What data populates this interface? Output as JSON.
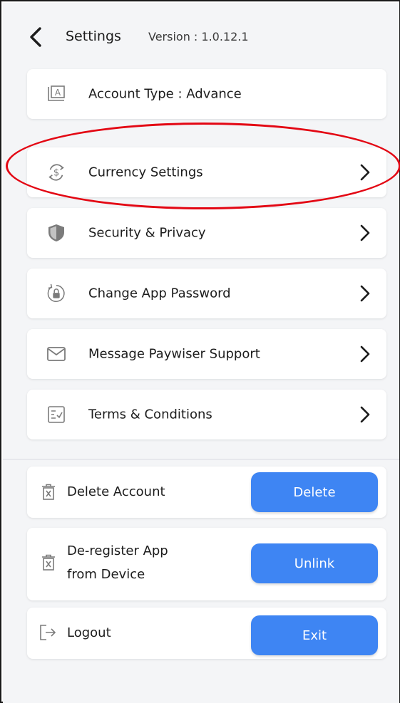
{
  "header": {
    "title": "Settings",
    "version": "Version : 1.0.12.1"
  },
  "menu": {
    "account_type": "Account Type : Advance",
    "currency": "Currency Settings",
    "security": "Security & Privacy",
    "password": "Change App Password",
    "support": "Message Paywiser Support",
    "terms": "Terms & Conditions"
  },
  "actions": {
    "delete": {
      "label": "Delete Account",
      "button": "Delete"
    },
    "deregister": {
      "label_line1": "De-register App",
      "label_line2": "from Device",
      "button": "Unlink"
    },
    "logout": {
      "label": "Logout",
      "button": "Exit"
    }
  },
  "icons": {
    "back": "chevron-left-icon",
    "account": "account-type-icon",
    "currency": "currency-exchange-icon",
    "security": "shield-icon",
    "password": "lock-refresh-icon",
    "support": "envelope-icon",
    "terms": "terms-document-icon",
    "delete": "trash-icon",
    "logout": "logout-icon"
  },
  "colors": {
    "accent": "#3e85f3",
    "highlight": "#e30613",
    "background": "#f4f5f7"
  }
}
